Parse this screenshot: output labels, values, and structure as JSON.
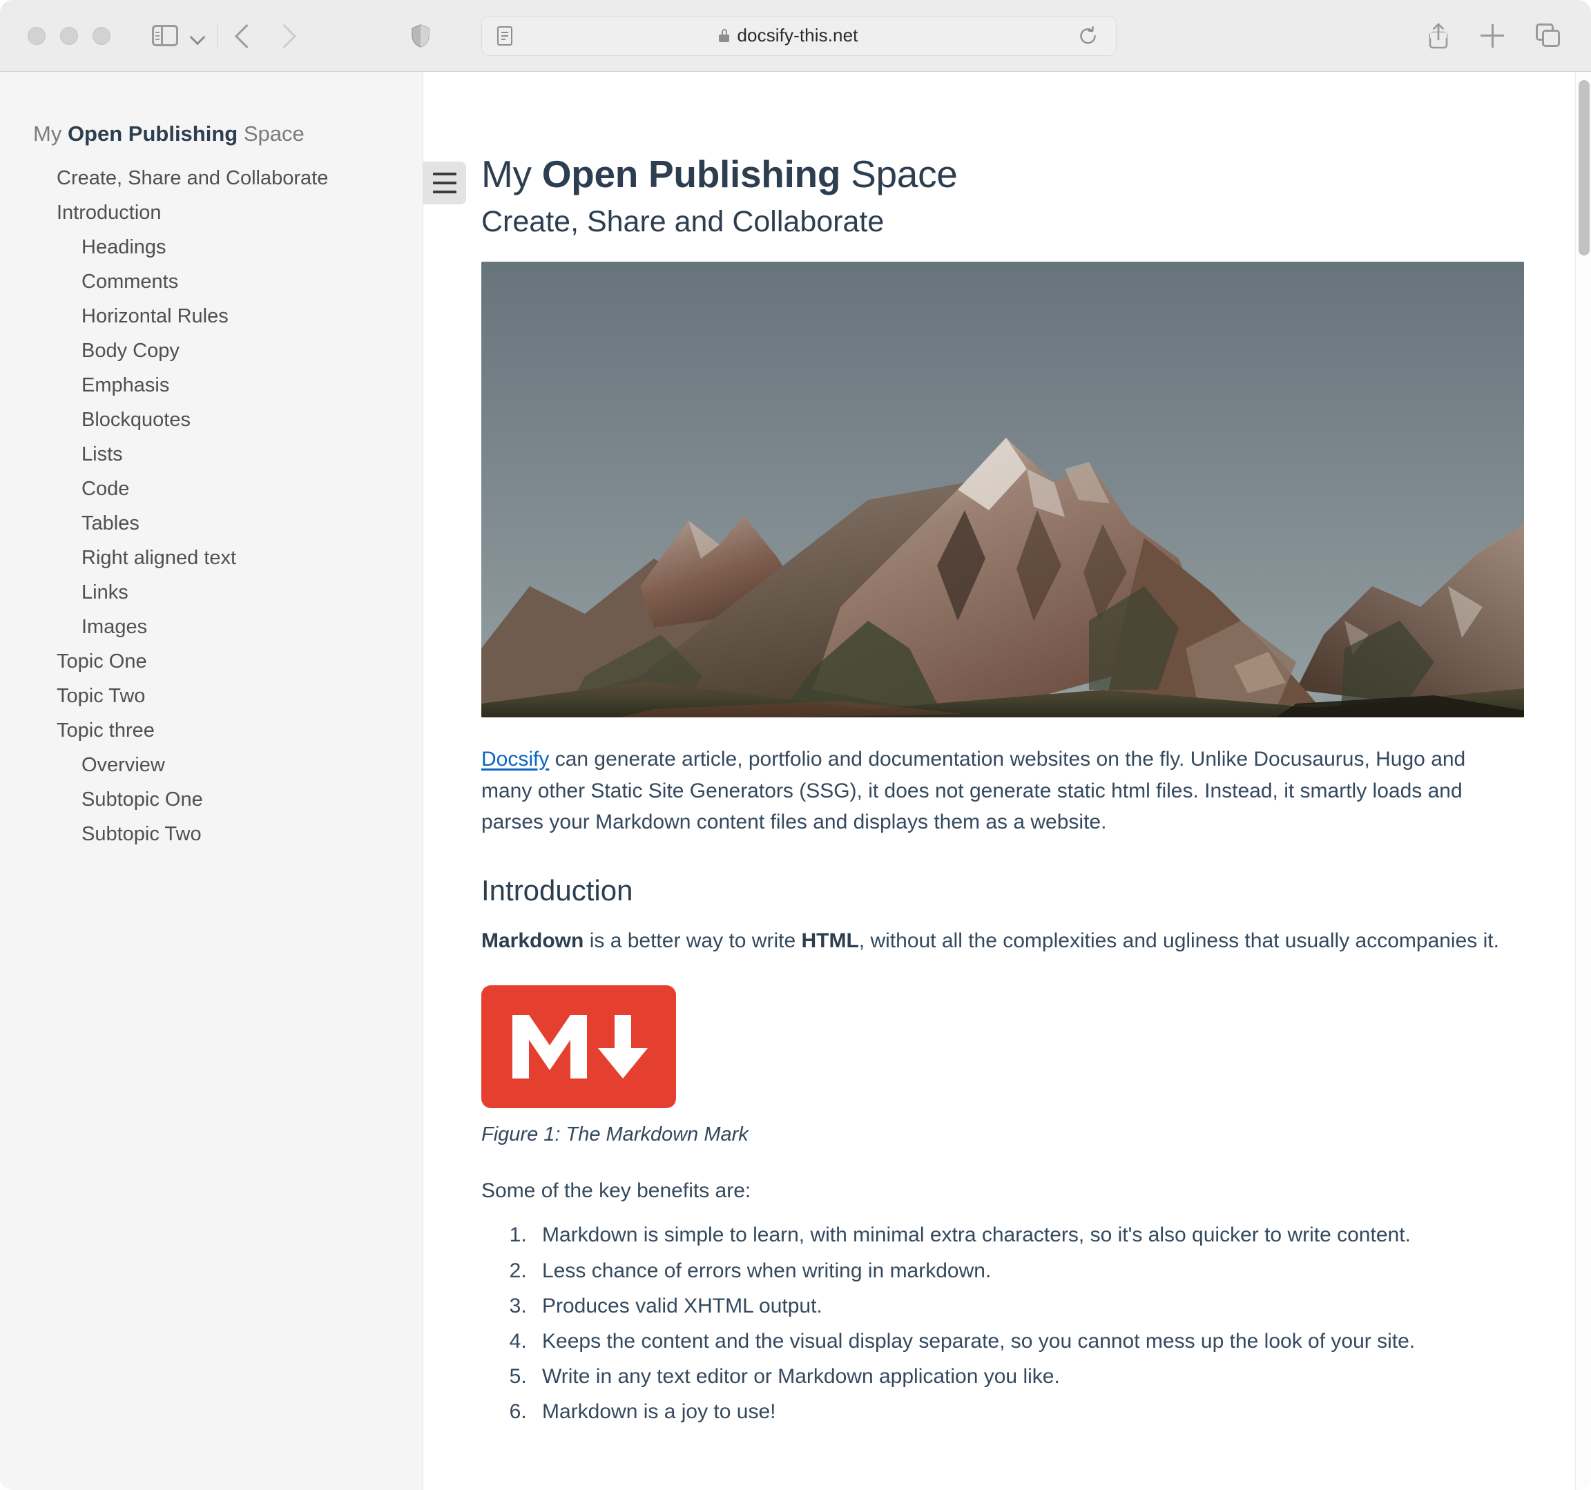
{
  "browser": {
    "url": "docsify-this.net",
    "traffic_lights": [
      "close",
      "minimize",
      "zoom"
    ],
    "icons": {
      "sidebar_toggle": "sidebar-toggle-icon",
      "tab_group_chevron": "chevron-down-icon",
      "back": "back-arrow-icon",
      "forward": "forward-arrow-icon",
      "shield": "privacy-shield-icon",
      "reader": "reader-view-icon",
      "lock": "lock-icon",
      "reload": "reload-icon",
      "share": "share-icon",
      "new_tab": "plus-icon",
      "tab_overview": "tab-overview-icon"
    }
  },
  "sidebar": {
    "title_prefix": "My ",
    "title_bold": "Open Publishing",
    "title_suffix": " Space",
    "items": [
      {
        "label": "Create, Share and Collaborate",
        "level": 1
      },
      {
        "label": "Introduction",
        "level": 1
      },
      {
        "label": "Headings",
        "level": 2
      },
      {
        "label": "Comments",
        "level": 2
      },
      {
        "label": "Horizontal Rules",
        "level": 2
      },
      {
        "label": "Body Copy",
        "level": 2
      },
      {
        "label": "Emphasis",
        "level": 2
      },
      {
        "label": "Blockquotes",
        "level": 2
      },
      {
        "label": "Lists",
        "level": 2
      },
      {
        "label": "Code",
        "level": 2
      },
      {
        "label": "Tables",
        "level": 2
      },
      {
        "label": "Right aligned text",
        "level": 2
      },
      {
        "label": "Links",
        "level": 2
      },
      {
        "label": "Images",
        "level": 2
      },
      {
        "label": "Topic One",
        "level": 1
      },
      {
        "label": "Topic Two",
        "level": 1
      },
      {
        "label": "Topic three",
        "level": 1
      },
      {
        "label": "Overview",
        "level": 2
      },
      {
        "label": "Subtopic One",
        "level": 2
      },
      {
        "label": "Subtopic Two",
        "level": 2
      }
    ]
  },
  "content": {
    "title_prefix": "My ",
    "title_bold": "Open Publishing",
    "title_suffix": " Space",
    "subtitle": "Create, Share and Collaborate",
    "hero_alt": "mountain-landscape-photo",
    "intro_link": "Docsify",
    "intro_paragraph": " can generate article, portfolio and documentation websites on the fly. Unlike Docusaurus, Hugo and many other Static Site Generators (SSG), it does not generate static html files. Instead, it smartly loads and parses your Markdown content files and displays them as a website.",
    "section_heading": "Introduction",
    "markdown_bold": "Markdown",
    "markdown_mid": " is a better way to write ",
    "html_bold": "HTML",
    "markdown_tail": ", without all the complexities and ugliness that usually accompanies it.",
    "figure_caption": "Figure 1: The Markdown Mark",
    "benefits_intro": "Some of the key benefits are:",
    "benefits": [
      "Markdown is simple to learn, with minimal extra characters, so it's also quicker to write content.",
      "Less chance of errors when writing in markdown.",
      "Produces valid XHTML output.",
      "Keeps the content and the visual display separate, so you cannot mess up the look of your site.",
      "Write in any text editor or Markdown application you like.",
      "Markdown is a joy to use!"
    ]
  },
  "colors": {
    "markdown_mark_red": "#e5402f",
    "link_blue": "#0a66c2",
    "sidebar_bg": "#f5f5f5",
    "toolbar_bg": "#ececec",
    "heading_text": "#2c3e50"
  }
}
